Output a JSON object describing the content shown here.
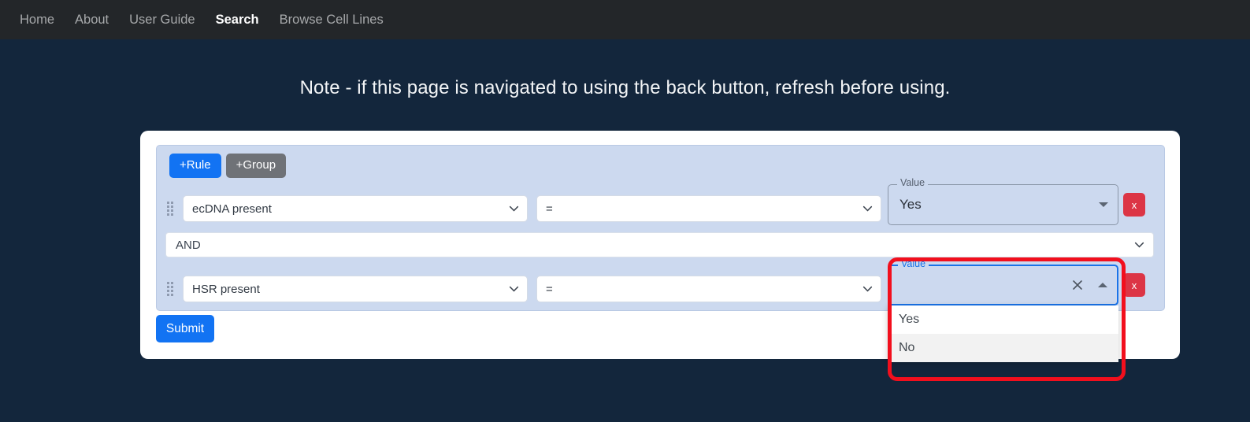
{
  "navbar": {
    "items": [
      {
        "label": "Home",
        "active": false
      },
      {
        "label": "About",
        "active": false
      },
      {
        "label": "User Guide",
        "active": false
      },
      {
        "label": "Search",
        "active": true
      },
      {
        "label": "Browse Cell Lines",
        "active": false
      }
    ],
    "background_color": "#232629",
    "active_color": "#ffffff",
    "inactive_color": "#a7a9ab"
  },
  "page": {
    "background_color": "#13263c",
    "note": "Note - if this page is navigated to using the back button, refresh before using."
  },
  "query_builder": {
    "add_rule_label": "+Rule",
    "add_group_label": "+Group",
    "add_rule_color": "#1273f3",
    "add_group_color": "#6f7277",
    "panel_background": "#ccd9ef",
    "rules": [
      {
        "field": "ecDNA present",
        "operator": "=",
        "value_label": "Value",
        "value": "Yes",
        "delete_label": "x",
        "focused": false,
        "drag_handle_icon": "drag-dots-icon"
      },
      {
        "field": "HSR present",
        "operator": "=",
        "value_label": "Value",
        "value": "",
        "delete_label": "x",
        "focused": true,
        "drag_handle_icon": "drag-dots-icon"
      }
    ],
    "conjunction": "AND",
    "value_options": [
      {
        "label": "Yes",
        "highlighted": false
      },
      {
        "label": "No",
        "highlighted": true
      }
    ],
    "submit_label": "Submit",
    "submit_color": "#1273f3",
    "delete_color": "#dc3545"
  },
  "annotation": {
    "color": "#f20f1d",
    "shape": "rounded-rectangle-highlight"
  }
}
